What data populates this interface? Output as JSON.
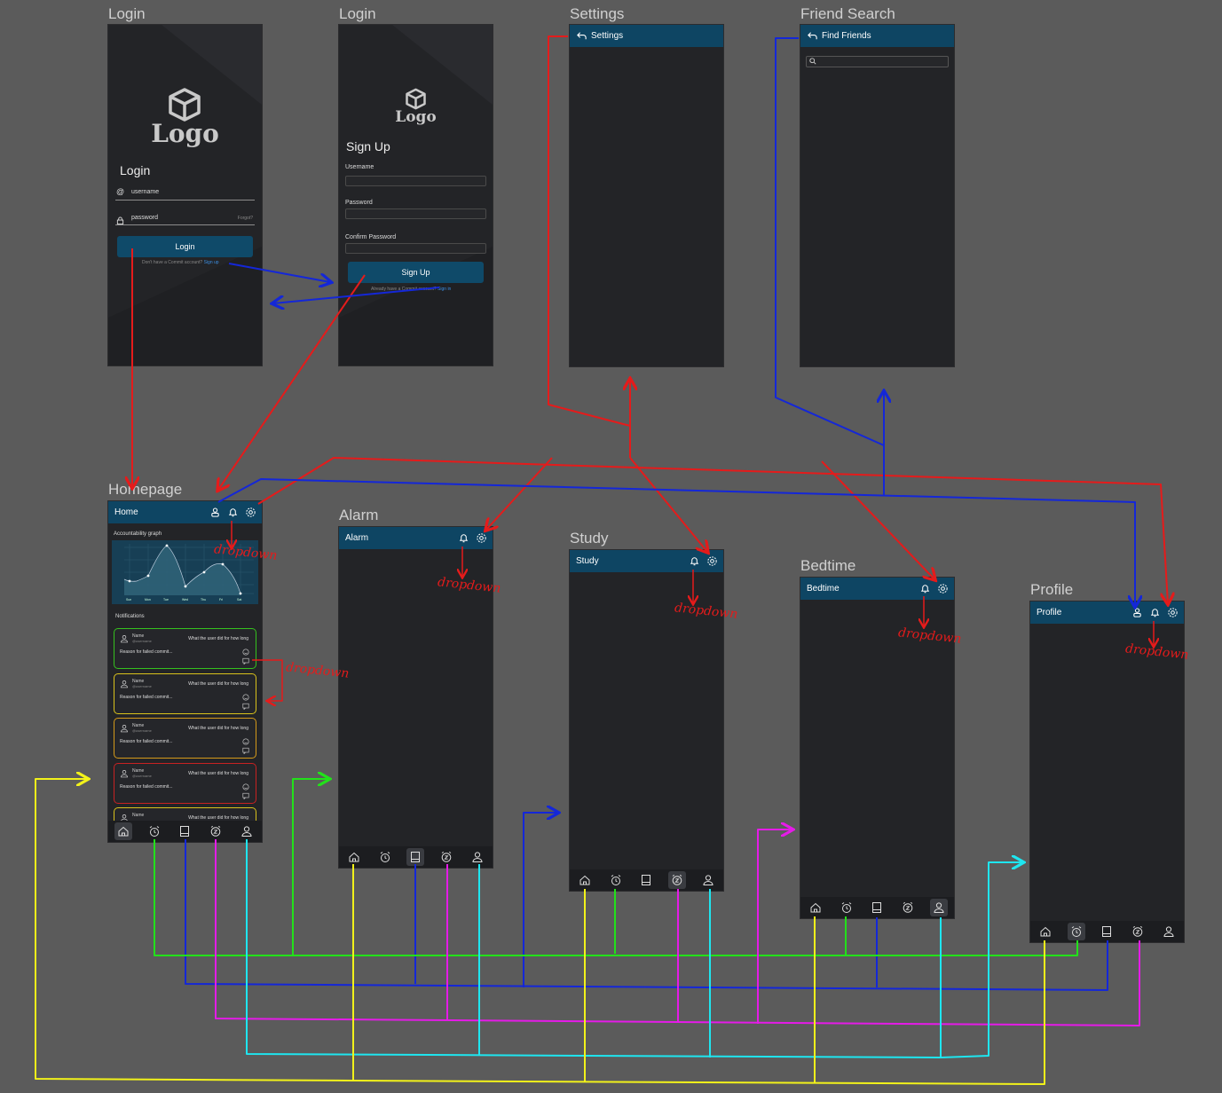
{
  "frames": {
    "login": {
      "label": "Login",
      "logo": "Logo",
      "heading": "Login",
      "username_prefix": "@",
      "username_placeholder": "username",
      "password_placeholder": "password",
      "forgot": "Forgot?",
      "button": "Login",
      "no_account": "Don't have a Commit account?",
      "signup_link": "Sign up"
    },
    "signup": {
      "label": "Login",
      "logo": "Logo",
      "heading": "Sign Up",
      "username_label": "Username",
      "password_label": "Password",
      "confirm_label": "Confirm Password",
      "button": "Sign Up",
      "already": "Already have a Commit account?",
      "signin_link": "Sign in"
    },
    "settings": {
      "label": "Settings",
      "title": "Settings"
    },
    "friend_search": {
      "label": "Friend Search",
      "title": "Find Friends"
    },
    "homepage": {
      "label": "Homepage",
      "title": "Home",
      "graph_title": "Accountability graph",
      "notifications_title": "Notifications",
      "days": [
        "Sun",
        "Mon",
        "Tue",
        "Wed",
        "Thu",
        "Fri",
        "Sat"
      ],
      "notifications": [
        {
          "name": "Name",
          "user": "@username",
          "what": "What the user did for how long",
          "reason": "Reason for failed commit...",
          "color": "#35c11e"
        },
        {
          "name": "Name",
          "user": "@username",
          "what": "What the user did for how long",
          "reason": "Reason for failed commit...",
          "color": "#d9c21c"
        },
        {
          "name": "Name",
          "user": "@username",
          "what": "What the user did for how long",
          "reason": "Reason for failed commit...",
          "color": "#d49a1a"
        },
        {
          "name": "Name",
          "user": "@username",
          "what": "What the user did for how long",
          "reason": "Reason for failed commit...",
          "color": "#c82222"
        },
        {
          "name": "Name",
          "user": "",
          "what": "What the user did for how long",
          "reason": "",
          "color": "#d9c21c"
        }
      ]
    },
    "alarm": {
      "label": "Alarm",
      "title": "Alarm"
    },
    "study": {
      "label": "Study",
      "title": "Study"
    },
    "bedtime": {
      "label": "Bedtime",
      "title": "Bedtime"
    },
    "profile": {
      "label": "Profile",
      "title": "Profile"
    }
  },
  "annotations": {
    "dropdown": "dropdown"
  },
  "arrow_colors": {
    "red": "#e51b1b",
    "blue": "#1427d8",
    "yellow": "#f2f21a",
    "green": "#22e11a",
    "magenta": "#e51be8",
    "cyan": "#1ee6f0"
  }
}
